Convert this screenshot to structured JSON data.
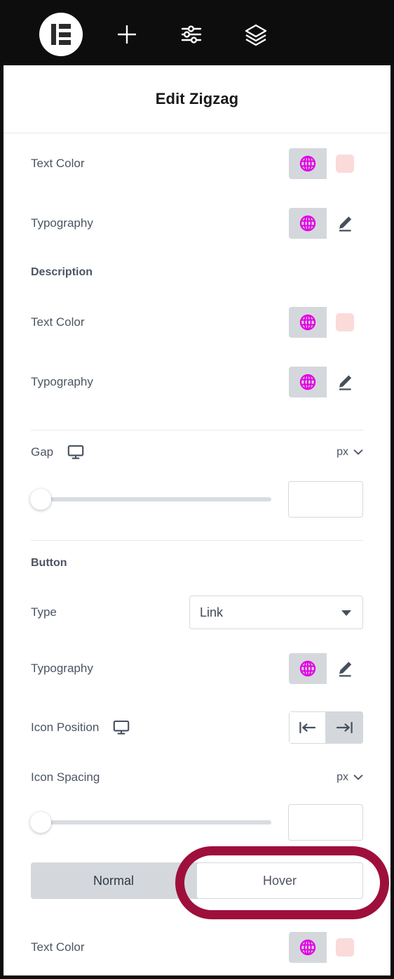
{
  "toolbar": {
    "logo": "elementor-logo",
    "items": [
      {
        "name": "add-element-button",
        "icon": "plus-icon"
      },
      {
        "name": "settings-button",
        "icon": "sliders-icon"
      },
      {
        "name": "navigator-button",
        "icon": "layers-icon"
      }
    ]
  },
  "header": {
    "title": "Edit Zigzag"
  },
  "panel": {
    "title_text_color": {
      "label": "Text Color",
      "globe_icon": "globe-icon",
      "swatch_color": "#fbdada"
    },
    "title_typography": {
      "label": "Typography",
      "globe_icon": "globe-icon",
      "edit_icon": "pencil-icon"
    },
    "description_section": {
      "heading": "Description",
      "text_color": {
        "label": "Text Color",
        "globe_icon": "globe-icon",
        "swatch_color": "#fbdada"
      },
      "typography": {
        "label": "Typography",
        "globe_icon": "globe-icon",
        "edit_icon": "pencil-icon"
      }
    },
    "gap": {
      "label": "Gap",
      "device_icon": "desktop-monitor-icon",
      "unit": "px",
      "unit_caret": "chevron-down-icon",
      "value": "",
      "slider_percent": 0
    },
    "button_section": {
      "heading": "Button",
      "type": {
        "label": "Type",
        "value": "Link",
        "caret": "caret-down-icon"
      },
      "typography": {
        "label": "Typography",
        "globe_icon": "globe-icon",
        "edit_icon": "pencil-icon"
      },
      "icon_position": {
        "label": "Icon Position",
        "device_icon": "desktop-monitor-icon",
        "options": [
          {
            "name": "icon-position-start",
            "icon": "arrow-to-left-bar-icon",
            "active": false
          },
          {
            "name": "icon-position-end",
            "icon": "arrow-to-right-bar-icon",
            "active": true
          }
        ]
      },
      "icon_spacing": {
        "label": "Icon Spacing",
        "unit": "px",
        "unit_caret": "chevron-down-icon",
        "value": "",
        "slider_percent": 0
      },
      "state_tabs": {
        "normal": "Normal",
        "hover": "Hover",
        "selected": "Hover"
      },
      "hover_text_color": {
        "label": "Text Color",
        "globe_icon": "globe-icon",
        "swatch_color": "#fbdada"
      }
    }
  },
  "annotation": {
    "shape": "ellipse-highlight",
    "color": "#9e0f3c",
    "targets": "Hover"
  },
  "colors": {
    "toolbar_bg": "#0d0d0d",
    "panel_bg": "#ffffff",
    "label_text": "#4b5563",
    "globe_magenta": "#e303e3",
    "control_gray": "#d4d8dd",
    "divider": "#e8eaed"
  }
}
